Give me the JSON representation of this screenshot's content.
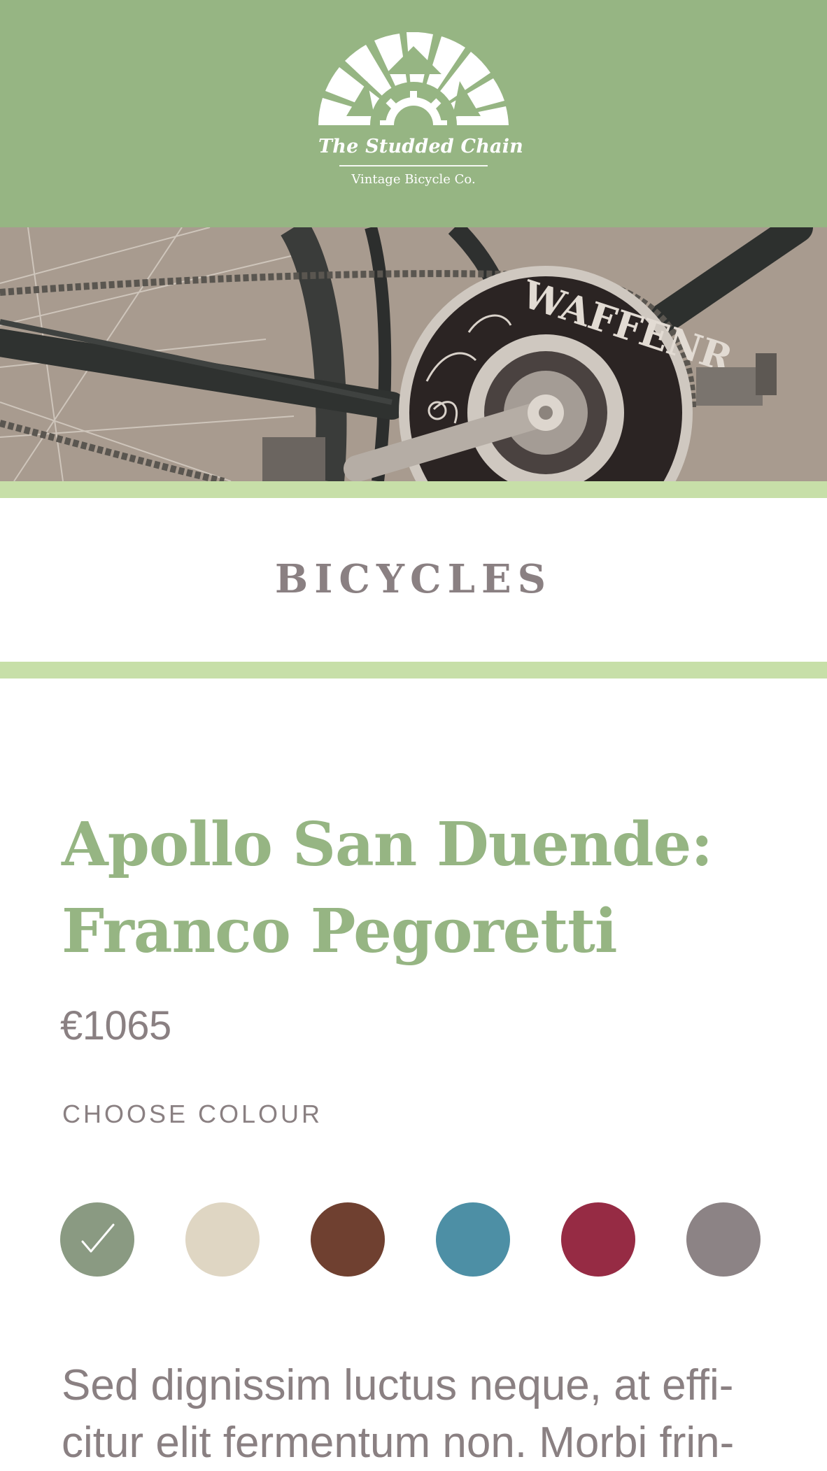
{
  "brand": {
    "name": "The Studded Chain",
    "tagline": "Vintage Bicycle Co.",
    "header_color": "#96b583",
    "logo_icons": [
      "sunburst-icon",
      "gear-icon"
    ]
  },
  "hero": {
    "image": "bicycle-chainring-photo",
    "chainring_text": "WAFFENR"
  },
  "category": {
    "title": "BICYCLES"
  },
  "product": {
    "title_line1": "Apollo San Duende:",
    "title_line2": "Franco Pegoretti",
    "price": "€1065",
    "colour_label": "CHOOSE COLOUR",
    "colours": [
      {
        "name": "sage",
        "hex": "#8a9a82",
        "selected": true
      },
      {
        "name": "cream",
        "hex": "#dfd6c3",
        "selected": false
      },
      {
        "name": "brown",
        "hex": "#6f4030",
        "selected": false
      },
      {
        "name": "teal",
        "hex": "#4d8fa5",
        "selected": false
      },
      {
        "name": "crimson",
        "hex": "#962b44",
        "selected": false
      },
      {
        "name": "grey",
        "hex": "#8c8385",
        "selected": false
      }
    ],
    "description_line1": "Sed dignissim luctus neque, at effi-",
    "description_line2": "citur elit fermentum non. Morbi frin-"
  },
  "colors": {
    "accent_green": "#96b583",
    "band_green": "#c7dfa8",
    "text_grey": "#8a8082"
  }
}
